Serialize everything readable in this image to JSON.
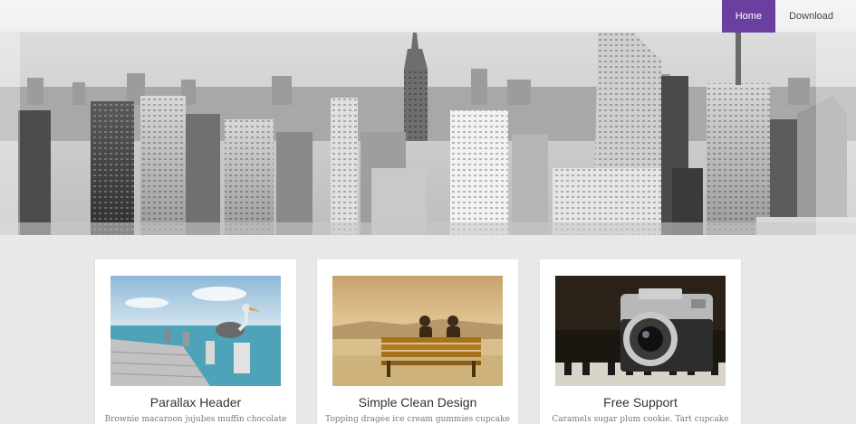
{
  "nav": {
    "items": [
      {
        "label": "Home",
        "active": true
      },
      {
        "label": "Download",
        "active": false
      }
    ]
  },
  "hero": {
    "image": "city-skyline-grayscale"
  },
  "cards": [
    {
      "image": "pelican-on-pier",
      "title": "Parallax Header",
      "text": "Brownie macaroon jujubes muffin chocolate"
    },
    {
      "image": "couple-on-bench-sunset",
      "title": "Simple Clean Design",
      "text": "Topping dragée ice cream gummies cupcake"
    },
    {
      "image": "vintage-camera",
      "title": "Free Support",
      "text": "Caramels sugar plum cookie. Tart cupcake"
    }
  ],
  "colors": {
    "accent": "#6a3fa0",
    "background": "#e8e8e8",
    "card": "#ffffff"
  }
}
